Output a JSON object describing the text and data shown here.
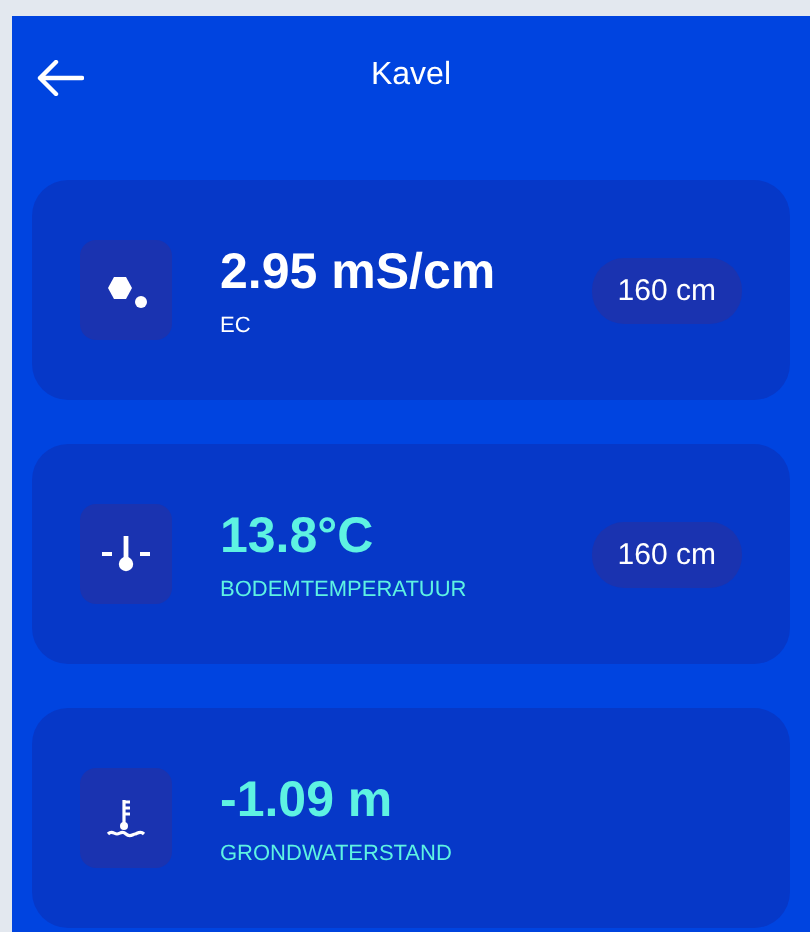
{
  "header": {
    "title": "Kavel"
  },
  "metrics": [
    {
      "kind": "ec",
      "value": "2.95 mS/cm",
      "label": "EC",
      "depth": "160 cm",
      "color": "#ffffff"
    },
    {
      "kind": "temperature",
      "value": "13.8°C",
      "label": "BODEMTEMPERATUUR",
      "depth": "160 cm",
      "color": "#5ef2e2"
    },
    {
      "kind": "groundwater",
      "value": "-1.09 m",
      "label": "GRONDWATERSTAND",
      "color": "#5ef2e2"
    }
  ]
}
